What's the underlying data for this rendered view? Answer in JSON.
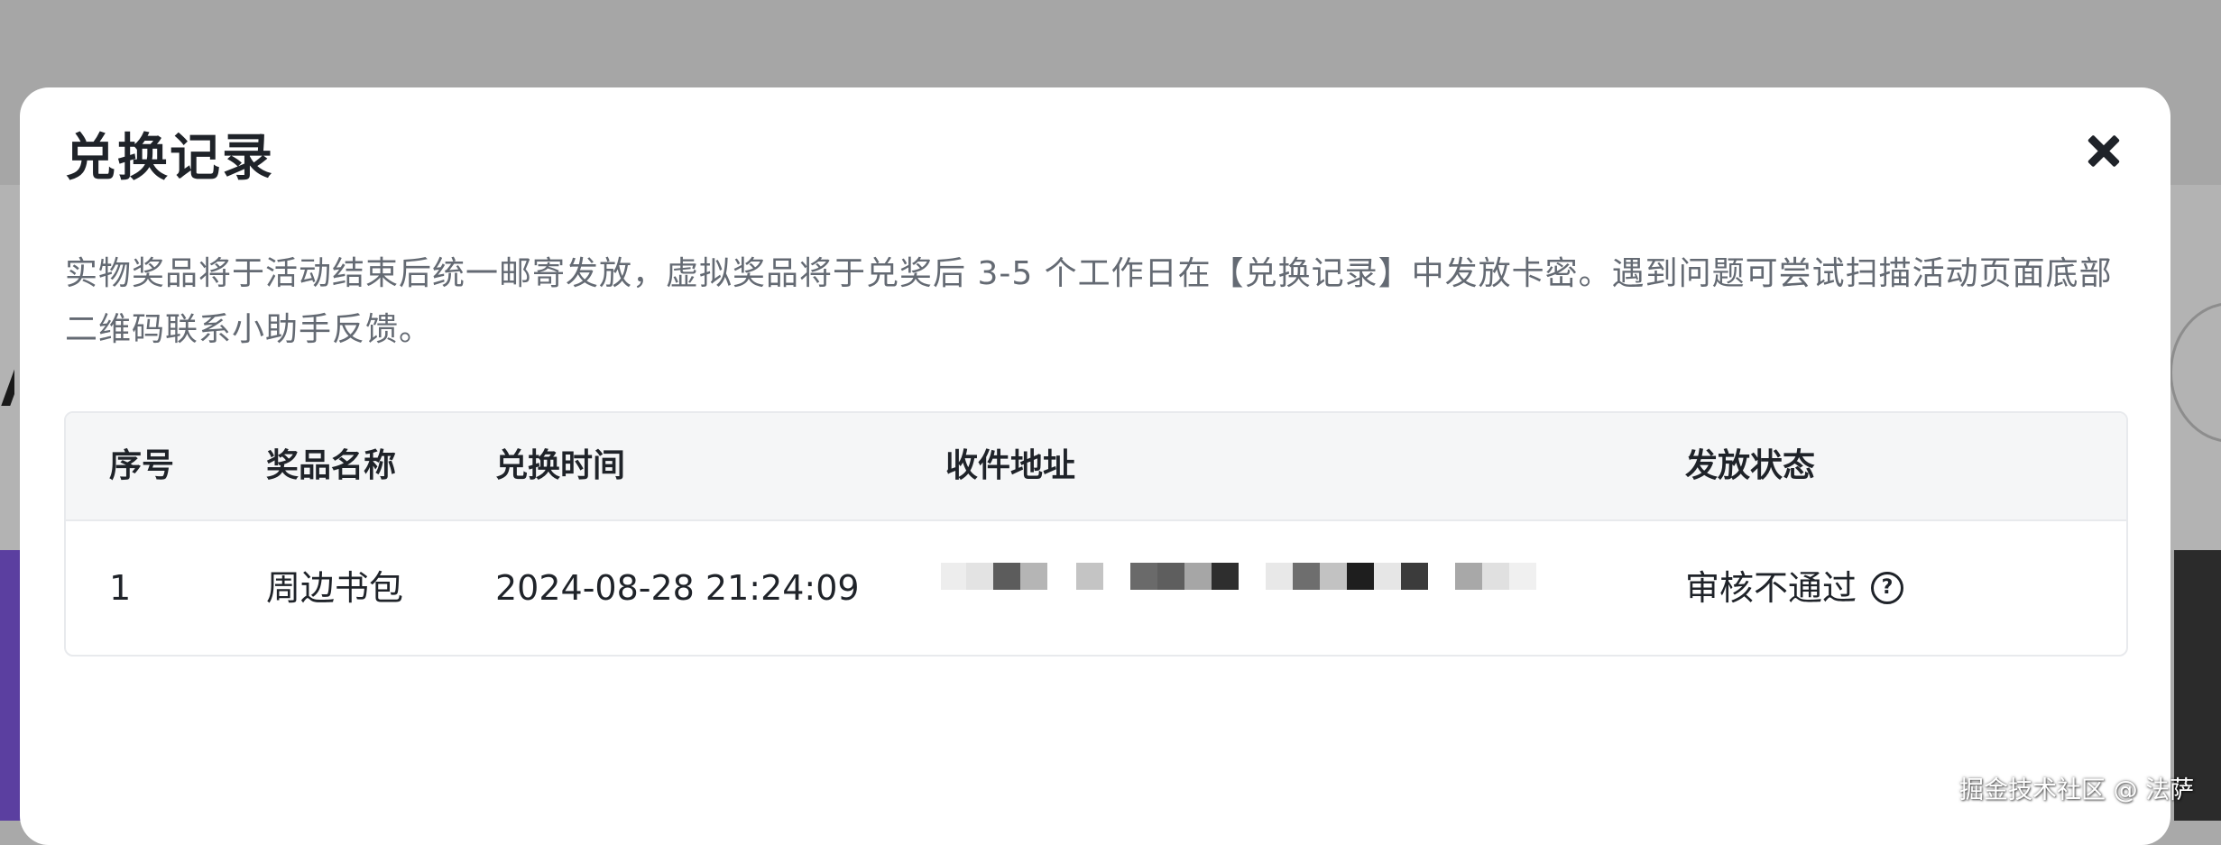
{
  "modal": {
    "title": "兑换记录",
    "close_icon": "close-icon",
    "notice": "实物奖品将于活动结束后统一邮寄发放，虚拟奖品将于兑奖后 3-5 个工作日在【兑换记录】中发放卡密。遇到问题可尝试扫描活动页面底部二维码联系小助手反馈。"
  },
  "table": {
    "headers": {
      "index": "序号",
      "prize_name": "奖品名称",
      "redeem_time": "兑换时间",
      "address": "收件地址",
      "status": "发放状态"
    },
    "rows": [
      {
        "index": "1",
        "prize_name": "周边书包",
        "redeem_time": "2024-08-28 21:24:09",
        "address": "",
        "status": "审核不通过",
        "status_icon": "question-circle-icon"
      }
    ]
  },
  "watermark": "掘金技术社区 @ 法萨",
  "colors": {
    "overlay": "#a9a9a9",
    "modal_bg": "#ffffff",
    "header_bg": "#f5f6f7",
    "text_primary": "#1f2329",
    "text_secondary": "#646a73",
    "border": "#e8eaed"
  }
}
